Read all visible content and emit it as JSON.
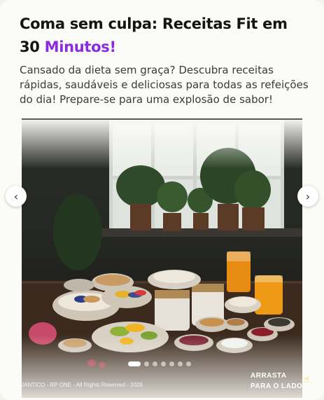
{
  "header": {
    "title_main": "Coma sem culpa: Receitas Fit em 30",
    "title_accent": "Minutos!",
    "description": "Cansado da dieta sem graça? Descubra receitas rápidas, saudáveis e deliciosas para todas as refeições do dia! Prepare-se para uma explosão de sabor!"
  },
  "carousel": {
    "prev_icon": "‹",
    "next_icon": "›",
    "slide_count": 7,
    "active_slide": 1,
    "image_description_icon": "food-photo"
  },
  "footer": {
    "copyright": "© QUANTICO - RP ONE - All Rights Reserved - 2026",
    "swipe_hint": "ARRASTA PARA O LADO",
    "swipe_icon": "hand-icon"
  },
  "colors": {
    "accent": "#8a2be2",
    "title": "#141414",
    "text": "#3a3a3a",
    "hint": "#f6c000"
  }
}
